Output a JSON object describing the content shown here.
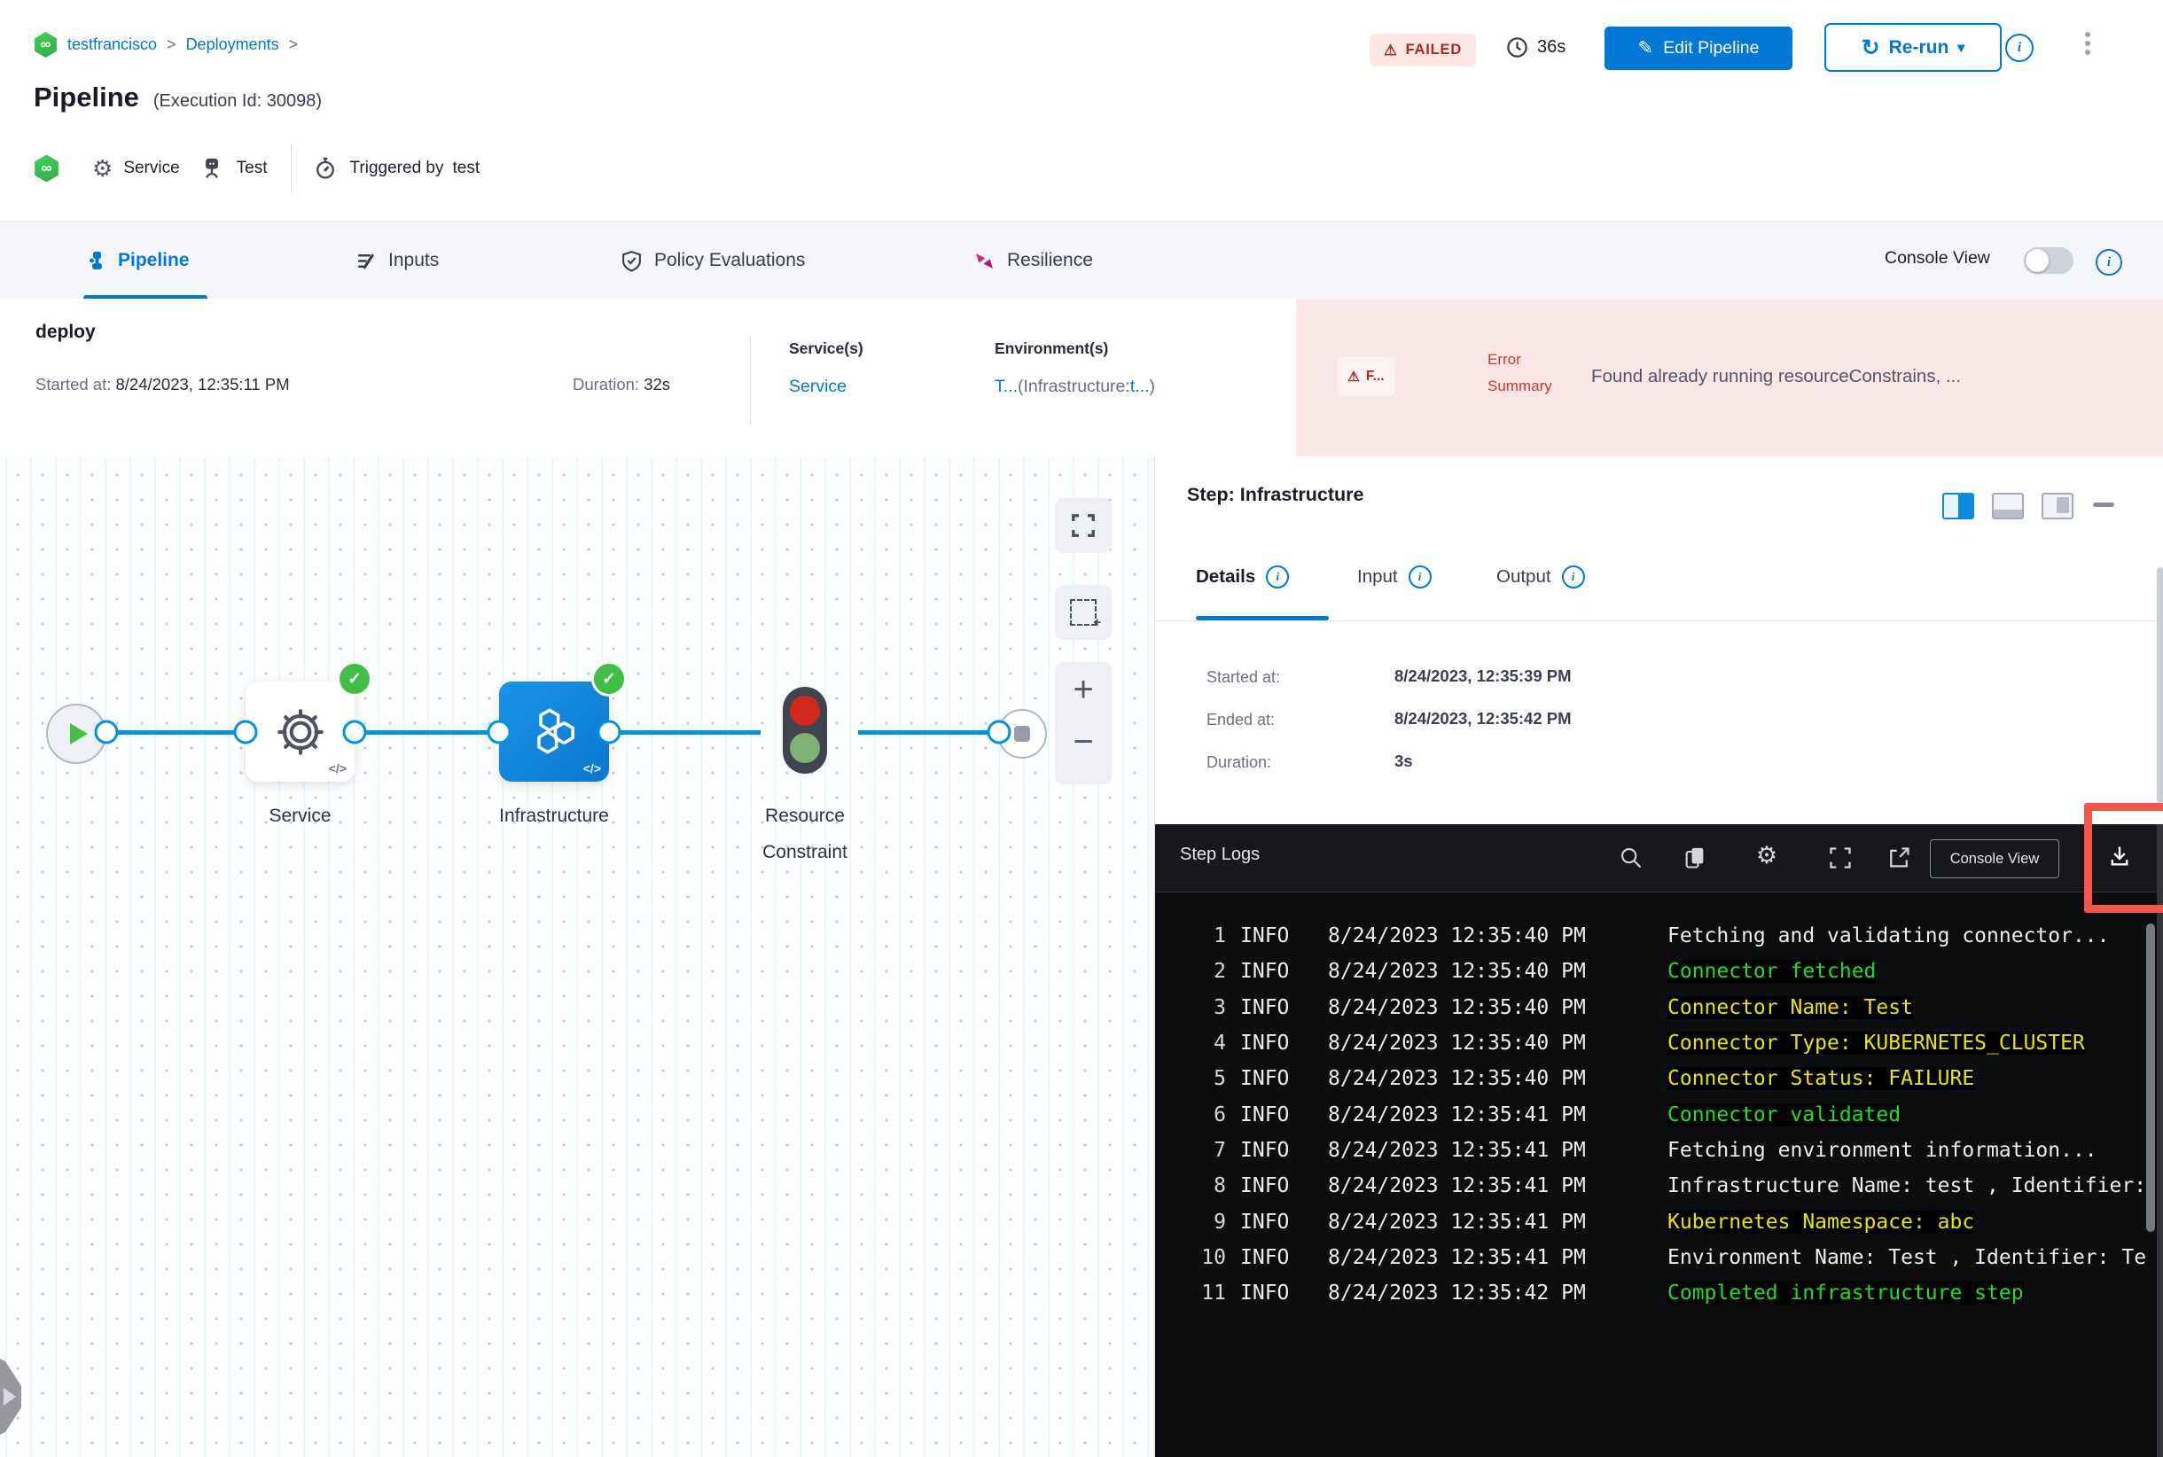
{
  "breadcrumb": {
    "project": "testfrancisco",
    "separator": ">",
    "section": "Deployments"
  },
  "header": {
    "title": "Pipeline",
    "execution_id": "(Execution Id: 30098)",
    "service_label": "Service",
    "test_label": "Test",
    "triggered_by_label": "Triggered by",
    "triggered_by_value": "test",
    "status_badge": "FAILED",
    "warning_glyph": "⚠",
    "elapsed": "36s",
    "edit_button": "Edit Pipeline",
    "rerun_button": "Re-run"
  },
  "tabbar": {
    "tabs": [
      {
        "label": "Pipeline"
      },
      {
        "label": "Inputs"
      },
      {
        "label": "Policy Evaluations"
      },
      {
        "label": "Resilience"
      }
    ],
    "console_view_label": "Console View"
  },
  "stage": {
    "name": "deploy",
    "started_label": "Started at:",
    "started_value": "8/24/2023, 12:35:11 PM",
    "duration_label": "Duration:",
    "duration_value": "32s",
    "services_label": "Service(s)",
    "service_link": "Service",
    "environments_label": "Environment(s)",
    "env_part1": "T...",
    "env_part2": "(Infrastructure:",
    "env_part3": "t...",
    "env_part4": ")",
    "failed_chip": "F...",
    "error_label_line1": "Error",
    "error_label_line2": "Summary",
    "error_text": "Found already running resourceConstrains, ..."
  },
  "graph": {
    "service_label": "Service",
    "infrastructure_label": "Infrastructure",
    "resource_constraint_line1": "Resource",
    "resource_constraint_line2": "Constraint",
    "code_glyph": "</>",
    "zoom_in": "+",
    "zoom_out": "−"
  },
  "step_panel": {
    "title": "Step: Infrastructure",
    "tabs": [
      {
        "label": "Details"
      },
      {
        "label": "Input"
      },
      {
        "label": "Output"
      }
    ],
    "details": {
      "started_label": "Started at:",
      "started_value": "8/24/2023, 12:35:39 PM",
      "ended_label": "Ended at:",
      "ended_value": "8/24/2023, 12:35:42 PM",
      "duration_label": "Duration:",
      "duration_value": "3s"
    }
  },
  "logs": {
    "title": "Step Logs",
    "console_view_button": "Console View",
    "colors": {
      "white": "#ececec",
      "green": "#1fdf20",
      "yellow": "#e8e600"
    },
    "lines": [
      {
        "n": "1",
        "level": "INFO",
        "time": "8/24/2023 12:35:40 PM",
        "msg": "Fetching and validating connector...",
        "color": "white"
      },
      {
        "n": "2",
        "level": "INFO",
        "time": "8/24/2023 12:35:40 PM",
        "msg": "Connector fetched",
        "color": "green"
      },
      {
        "n": "3",
        "level": "INFO",
        "time": "8/24/2023 12:35:40 PM",
        "msg": "Connector Name: Test",
        "color": "yellow"
      },
      {
        "n": "4",
        "level": "INFO",
        "time": "8/24/2023 12:35:40 PM",
        "msg": "Connector Type: KUBERNETES_CLUSTER",
        "color": "yellow"
      },
      {
        "n": "5",
        "level": "INFO",
        "time": "8/24/2023 12:35:40 PM",
        "msg": "Connector Status: FAILURE",
        "color": "yellow"
      },
      {
        "n": "6",
        "level": "INFO",
        "time": "8/24/2023 12:35:41 PM",
        "msg": "Connector validated",
        "color": "green"
      },
      {
        "n": "7",
        "level": "INFO",
        "time": "8/24/2023 12:35:41 PM",
        "msg": "Fetching environment information...",
        "color": "white"
      },
      {
        "n": "8",
        "level": "INFO",
        "time": "8/24/2023 12:35:41 PM",
        "msg": "Infrastructure Name: test , Identifier:",
        "color": "white"
      },
      {
        "n": "9",
        "level": "INFO",
        "time": "8/24/2023 12:35:41 PM",
        "msg": "Kubernetes Namespace: abc",
        "color": "yellow"
      },
      {
        "n": "10",
        "level": "INFO",
        "time": "8/24/2023 12:35:41 PM",
        "msg": "Environment Name: Test , Identifier: Te",
        "color": "white"
      },
      {
        "n": "11",
        "level": "INFO",
        "time": "8/24/2023 12:35:42 PM",
        "msg": "Completed infrastructure step",
        "color": "green"
      }
    ]
  },
  "colors": {
    "accent_blue": "#0278d5",
    "port_blue": "#0092e4",
    "node_blue": "#0b7fd6",
    "success_green": "#3fbf44",
    "error_red": "#b02720",
    "error_bg": "#fbe7e5",
    "highlight_red": "#f5554b",
    "log_bg": "#0c0d0f"
  }
}
